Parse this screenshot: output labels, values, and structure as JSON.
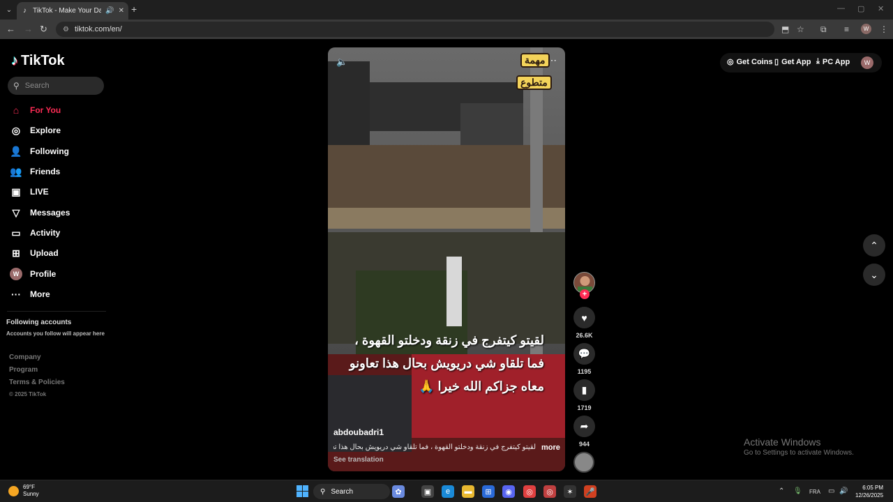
{
  "browser": {
    "tab_title": "TikTok - Make Your Day",
    "url": "tiktok.com/en/"
  },
  "sidebar": {
    "logo": "TikTok",
    "search_placeholder": "Search",
    "items": [
      {
        "label": "For You",
        "icon": "home-icon",
        "active": true
      },
      {
        "label": "Explore",
        "icon": "compass-icon"
      },
      {
        "label": "Following",
        "icon": "user-icon"
      },
      {
        "label": "Friends",
        "icon": "friends-icon"
      },
      {
        "label": "LIVE",
        "icon": "live-icon"
      },
      {
        "label": "Messages",
        "icon": "send-icon"
      },
      {
        "label": "Activity",
        "icon": "activity-icon"
      },
      {
        "label": "Upload",
        "icon": "upload-icon"
      },
      {
        "label": "Profile",
        "icon": "avatar",
        "avatar_letter": "W"
      },
      {
        "label": "More",
        "icon": "more-icon"
      }
    ],
    "following_heading": "Following accounts",
    "following_sub": "Accounts you follow will appear here",
    "footer": [
      "Company",
      "Program",
      "Terms & Policies"
    ],
    "copyright": "© 2025 TikTok"
  },
  "video": {
    "badge_line1": "مهمة",
    "badge_line2": "متطوع",
    "caption": "لقيتو كيتفرج في زنقة ودخلتو القهوة ، فما تلقاو شي دريويش بحال هذا تعاونو معاه جزاكم الله خيرا 🙏",
    "author": "abdoubadri1",
    "description": "لقيتو كيتفرج في زنقة ودخلتو القهوة ، فما تلقاو شي دريويش بحال هذا تعاونو",
    "more": "more",
    "see_translation": "See translation"
  },
  "actions": {
    "likes": "26.6K",
    "comments": "1195",
    "saves": "1719",
    "shares": "944"
  },
  "topbar": {
    "get_coins": "Get Coins",
    "get_app": "Get App",
    "pc_app": "PC App",
    "avatar_letter": "W"
  },
  "watermark": {
    "line1": "Activate Windows",
    "line2": "Go to Settings to activate Windows."
  },
  "taskbar": {
    "temp": "69°F",
    "condition": "Sunny",
    "search": "Search",
    "lang": "FRA",
    "time": "6:05 PM",
    "date": "12/26/2025"
  }
}
